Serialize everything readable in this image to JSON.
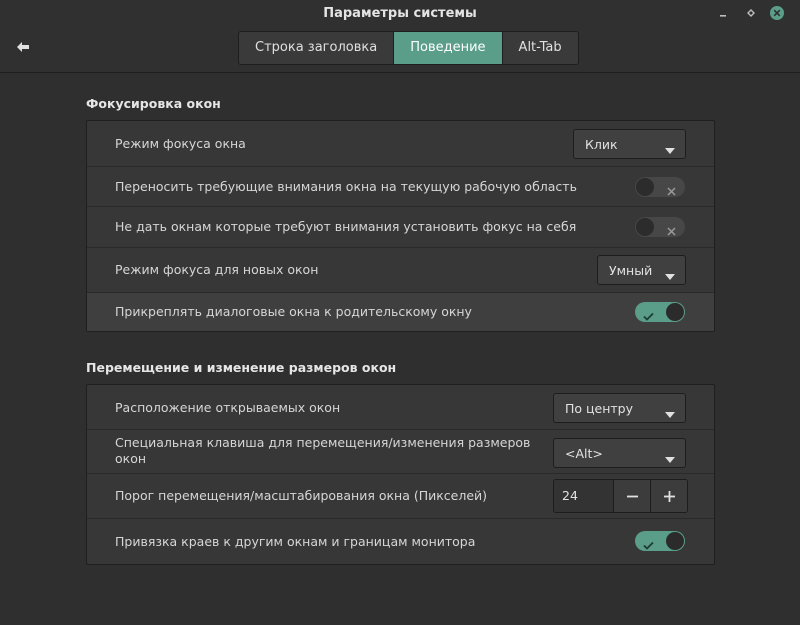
{
  "window": {
    "title": "Параметры системы",
    "controls": {
      "minimize": "minimize-icon",
      "maximize": "maximize-icon",
      "close": "close-icon"
    }
  },
  "header": {
    "back_icon": "arrow-left-icon",
    "tabs": [
      {
        "label": "Строка заголовка",
        "active": false
      },
      {
        "label": "Поведение",
        "active": true
      },
      {
        "label": "Alt-Tab",
        "active": false
      }
    ]
  },
  "colors": {
    "accent": "#5a9e8a",
    "background": "#2f2f2f",
    "panel": "#373737"
  },
  "focus_section": {
    "title": "Фокусировка окон",
    "rows": [
      {
        "label": "Режим фокуса окна",
        "control": "dropdown",
        "value": "Клик"
      },
      {
        "label": "Переносить требующие внимания окна на текущую рабочую область",
        "control": "switch",
        "on": false
      },
      {
        "label": "Не дать окнам которые требуют внимания установить фокус на себя",
        "control": "switch",
        "on": false
      },
      {
        "label": "Режим фокуса для новых окон",
        "control": "dropdown",
        "value": "Умный"
      },
      {
        "label": "Прикреплять диалоговые окна к родительскому окну",
        "control": "switch",
        "on": true
      }
    ]
  },
  "move_section": {
    "title": "Перемещение и изменение размеров окон",
    "rows": [
      {
        "label": "Расположение открываемых окон",
        "control": "dropdown",
        "value": "По центру"
      },
      {
        "label": "Специальная клавиша для перемещения/изменения размеров окон",
        "control": "dropdown",
        "value": "<Alt>"
      },
      {
        "label": "Порог перемещения/масштабирования окна (Пикселей)",
        "control": "spin",
        "value": "24"
      },
      {
        "label": "Привязка краев к другим окнам и границам монитора",
        "control": "switch",
        "on": true
      }
    ]
  }
}
